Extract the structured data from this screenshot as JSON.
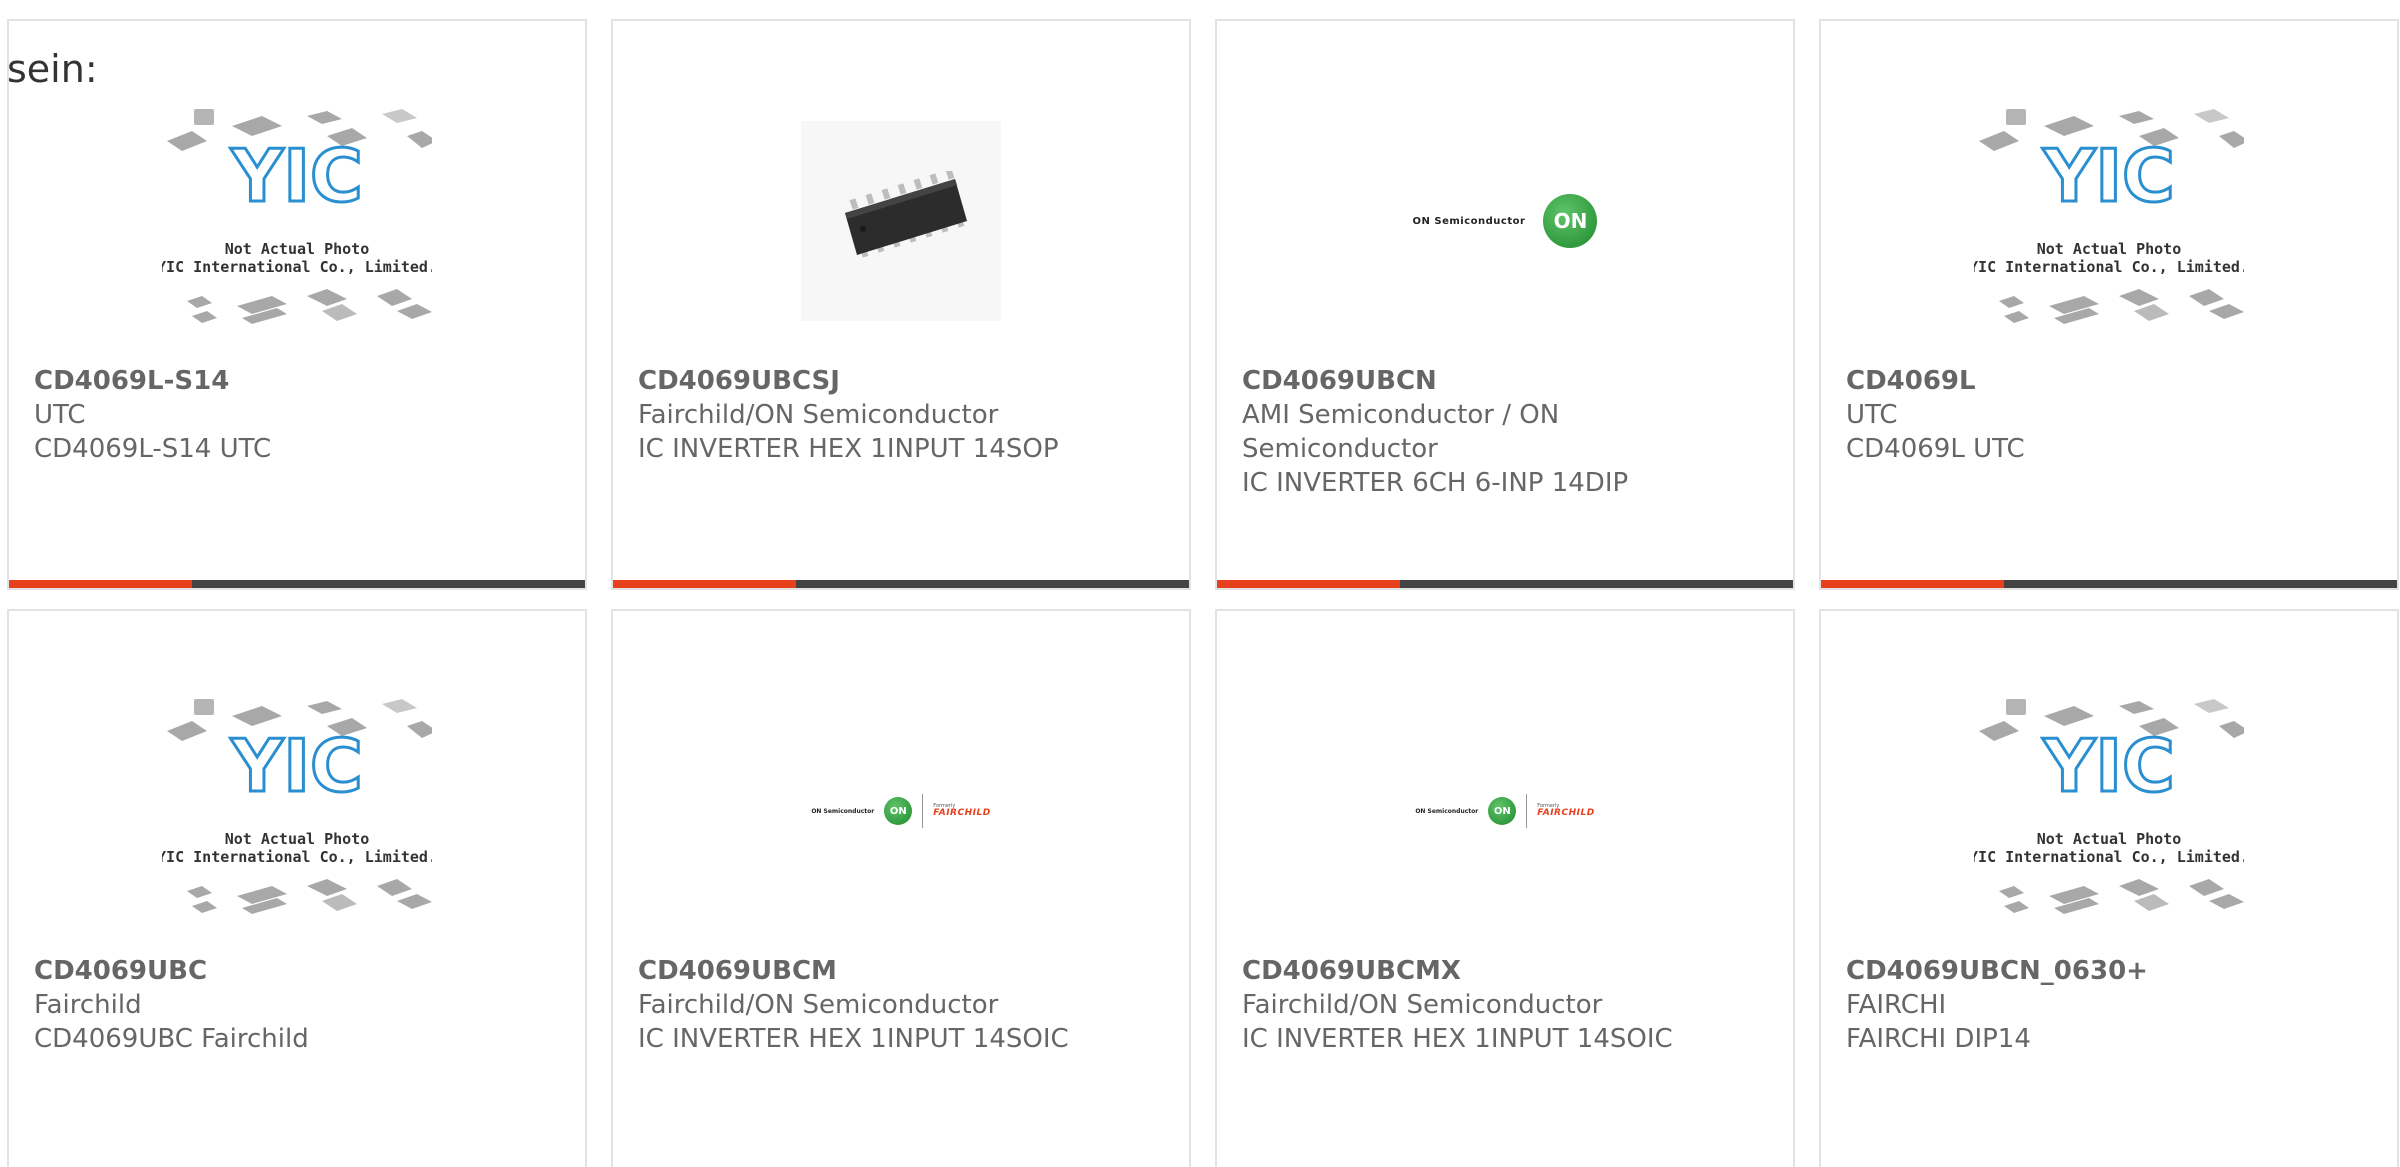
{
  "intro_text": "sein:",
  "brand_colors": {
    "accent": "#e8401c",
    "bar": "#444444",
    "text": "#666666"
  },
  "placeholder": {
    "line1": "Not Actual Photo",
    "line2": "YIC International Co., Limited."
  },
  "logos": {
    "on_semi": "ON Semiconductor",
    "on": "ON",
    "formerly": "Formerly",
    "fairchild": "FAIRCHILD"
  },
  "products": [
    {
      "part": "CD4069L-S14",
      "maker": "UTC",
      "desc": "CD4069L-S14 UTC",
      "image": "yic-placeholder"
    },
    {
      "part": "CD4069UBCSJ",
      "maker": "Fairchild/ON Semiconductor",
      "desc": "IC INVERTER HEX 1INPUT 14SOP",
      "image": "chip-photo"
    },
    {
      "part": "CD4069UBCN",
      "maker": "AMI Semiconductor / ON Semiconductor",
      "desc": "IC INVERTER 6CH 6-INP 14DIP",
      "image": "on-logo"
    },
    {
      "part": "CD4069L",
      "maker": "UTC",
      "desc": "CD4069L UTC",
      "image": "yic-placeholder"
    },
    {
      "part": "CD4069UBC",
      "maker": "Fairchild",
      "desc": "CD4069UBC Fairchild",
      "image": "yic-placeholder"
    },
    {
      "part": "CD4069UBCM",
      "maker": "Fairchild/ON Semiconductor",
      "desc": "IC INVERTER HEX 1INPUT 14SOIC",
      "image": "on-fairchild-logo"
    },
    {
      "part": "CD4069UBCMX",
      "maker": "Fairchild/ON Semiconductor",
      "desc": "IC INVERTER HEX 1INPUT 14SOIC",
      "image": "on-fairchild-logo"
    },
    {
      "part": "CD4069UBCN_0630+",
      "maker": "FAIRCHI",
      "desc": "FAIRCHI DIP14",
      "image": "yic-placeholder"
    }
  ]
}
